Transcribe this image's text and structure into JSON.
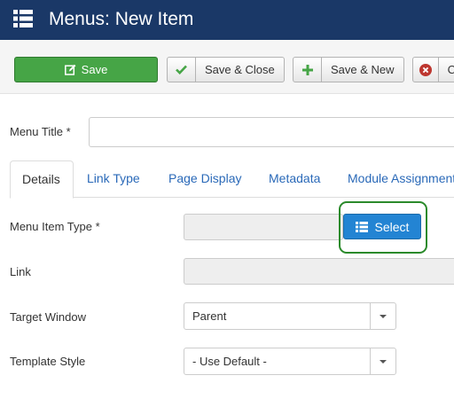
{
  "header": {
    "title": "Menus: New Item",
    "icon": "list-icon"
  },
  "toolbar": {
    "save": "Save",
    "save_close": "Save & Close",
    "save_new": "Save & New",
    "cancel": "C"
  },
  "form": {
    "menu_title": {
      "label": "Menu Title *",
      "value": ""
    },
    "menu_item_type": {
      "label": "Menu Item Type *",
      "value": "",
      "button": "Select"
    },
    "link": {
      "label": "Link",
      "value": ""
    },
    "target_window": {
      "label": "Target Window",
      "selected": "Parent"
    },
    "template_style": {
      "label": "Template Style",
      "selected": "- Use Default -"
    }
  },
  "tabs": [
    {
      "label": "Details",
      "active": true
    },
    {
      "label": "Link Type"
    },
    {
      "label": "Page Display"
    },
    {
      "label": "Metadata"
    },
    {
      "label": "Module Assignment"
    }
  ],
  "colors": {
    "header_bg": "#1a3867",
    "save_green": "#46a546",
    "select_blue": "#2384d3",
    "highlight_green": "#2b8a2b",
    "link_blue": "#2a69b8"
  }
}
